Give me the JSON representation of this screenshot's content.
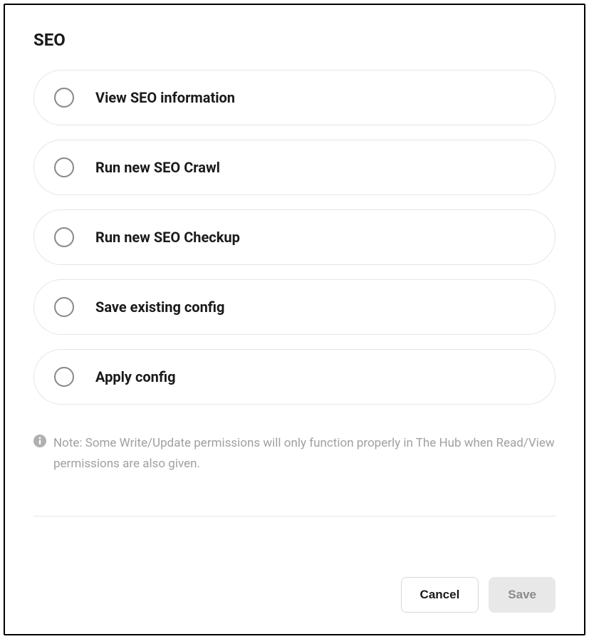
{
  "section": {
    "title": "SEO"
  },
  "options": [
    {
      "label": "View SEO information"
    },
    {
      "label": "Run new SEO Crawl"
    },
    {
      "label": "Run new SEO Checkup"
    },
    {
      "label": "Save existing config"
    },
    {
      "label": "Apply config"
    }
  ],
  "note": {
    "prefix": "Note: ",
    "text": "Some Write/Update permissions will only function properly in The Hub when Read/View permissions are also given."
  },
  "buttons": {
    "cancel": "Cancel",
    "save": "Save"
  }
}
